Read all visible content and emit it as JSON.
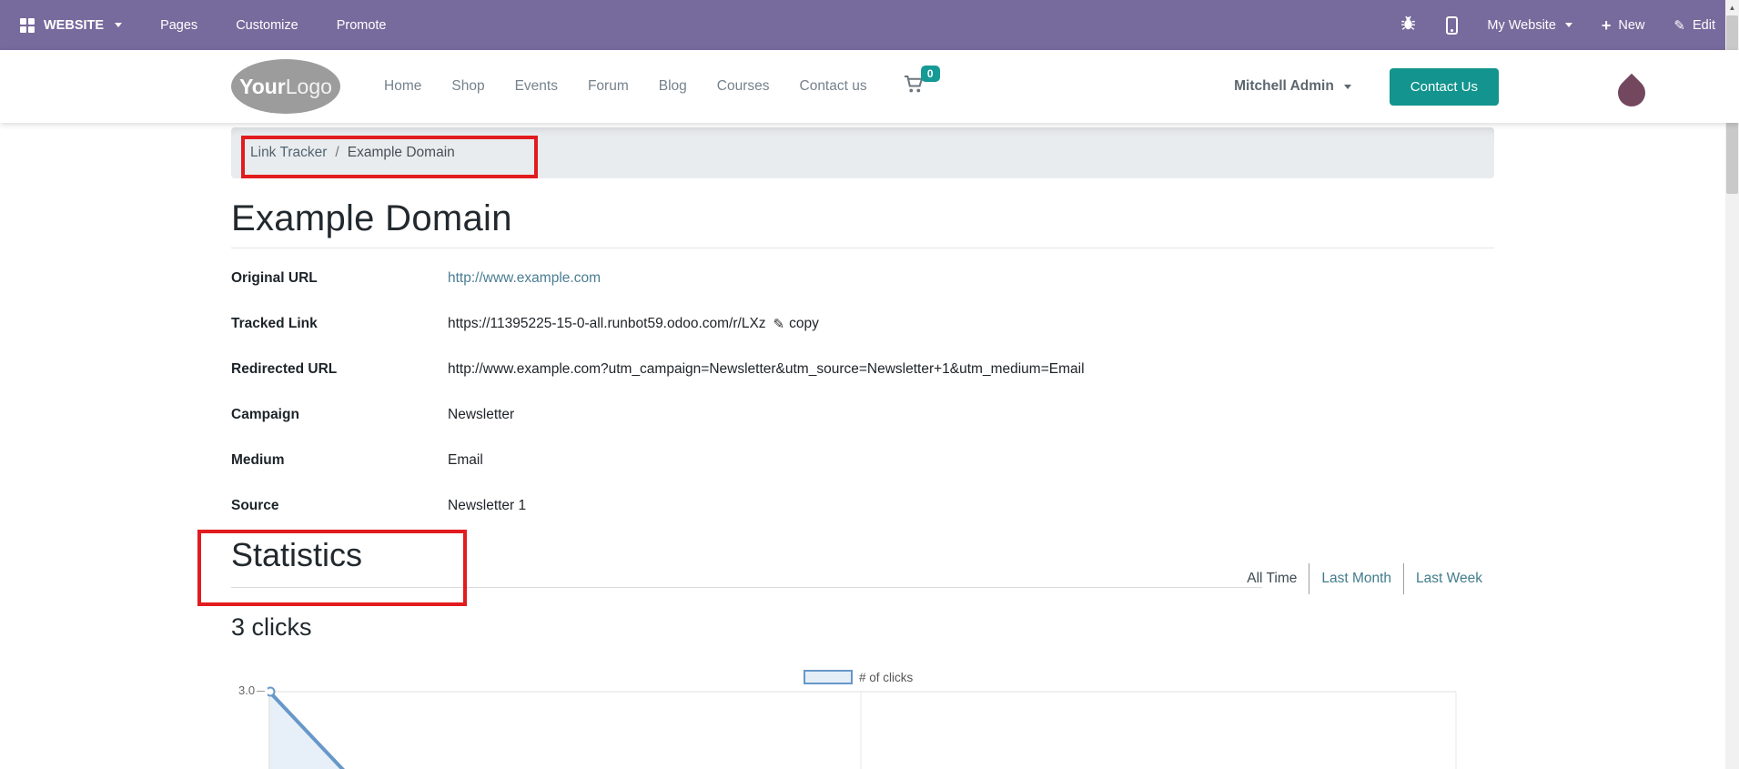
{
  "editor_bar": {
    "website_label": "WEBSITE",
    "menu_items": [
      "Pages",
      "Customize",
      "Promote"
    ],
    "my_website_label": "My Website",
    "new_label": "New",
    "edit_label": "Edit"
  },
  "header": {
    "logo_bold": "Your",
    "logo_light": "Logo",
    "nav_items": [
      "Home",
      "Shop",
      "Events",
      "Forum",
      "Blog",
      "Courses",
      "Contact us"
    ],
    "cart_count": "0",
    "user_name": "Mitchell Admin",
    "contact_button_label": "Contact Us"
  },
  "breadcrumb": {
    "link": "Link Tracker",
    "separator": "/",
    "current": "Example Domain"
  },
  "content": {
    "title": "Example Domain",
    "fields": [
      {
        "label": "Original URL",
        "value": "http://www.example.com"
      },
      {
        "label": "Tracked Link",
        "value": "https://11395225-15-0-all.runbot59.odoo.com/r/LXz"
      },
      {
        "label": "Redirected URL",
        "value": "http://www.example.com?utm_campaign=Newsletter&utm_source=Newsletter+1&utm_medium=Email"
      },
      {
        "label": "Campaign",
        "value": "Newsletter"
      },
      {
        "label": "Medium",
        "value": "Email"
      },
      {
        "label": "Source",
        "value": "Newsletter 1"
      }
    ],
    "copy_label": "copy",
    "statistics_heading": "Statistics",
    "clicks_summary": "3 clicks",
    "filters": {
      "all_time": "All Time",
      "last_month": "Last Month",
      "last_week": "Last Week",
      "active": "All Time"
    }
  },
  "chart_data": {
    "type": "area",
    "title": "",
    "legend": [
      "# of clicks"
    ],
    "legend_position": "top-center",
    "grid": true,
    "y_tick_labels_visible": [
      "3.0"
    ],
    "series": [
      {
        "name": "# of clicks",
        "points_visible": [
          {
            "x_position": "left edge of plot",
            "y": 3.0
          }
        ],
        "shape": "open circle marker at 3.0 with thick line descending steeply to the right; light blue area fill below; rest of chart cut off by viewport bottom"
      }
    ]
  },
  "colors": {
    "editor_bar_bg": "#776a9c",
    "button_teal": "#13948e",
    "badge_teal": "#169a96",
    "link_teal": "#4a7d93",
    "annotation_red": "#e11b1e",
    "chart_line_blue": "#6798c9",
    "chart_fill_blue": "#e7f0f8",
    "avatar_plum": "#73485f",
    "breadcrumb_bg": "#e9ecef"
  }
}
